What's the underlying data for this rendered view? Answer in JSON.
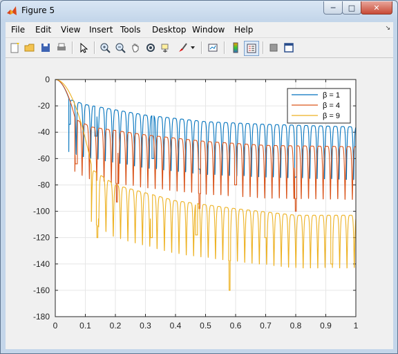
{
  "window": {
    "title": "Figure 5"
  },
  "window_controls": {
    "minimize": "─",
    "maximize": "□",
    "close": "✕"
  },
  "menu": {
    "items": [
      "File",
      "Edit",
      "View",
      "Insert",
      "Tools",
      "Desktop",
      "Window",
      "Help"
    ],
    "overflow_arrow": "↘"
  },
  "toolbar": {
    "icons": [
      "new-figure-icon",
      "open-file-icon",
      "save-icon",
      "print-icon",
      "pointer-icon",
      "zoom-in-icon",
      "zoom-out-icon",
      "pan-icon",
      "rotate-icon",
      "data-cursor-icon",
      "brush-icon",
      "brush-dropdown-icon",
      "link-plot-icon",
      "colorbar-icon",
      "legend-icon",
      "hide-plot-tools-icon",
      "show-plot-tools-icon"
    ]
  },
  "colors": {
    "beta1": "#0072BD",
    "beta4": "#D95319",
    "beta9": "#EDB120"
  },
  "chart_data": {
    "type": "line",
    "title": "",
    "xlabel": "",
    "ylabel": "",
    "xlim": [
      0,
      1
    ],
    "ylim": [
      -180,
      0
    ],
    "x_ticks": [
      "0",
      "0.1",
      "0.2",
      "0.3",
      "0.4",
      "0.5",
      "0.6",
      "0.7",
      "0.8",
      "0.9",
      "1"
    ],
    "y_ticks": [
      "0",
      "-20",
      "-40",
      "-60",
      "-80",
      "-100",
      "-120",
      "-140",
      "-160",
      "-180"
    ],
    "grid": true,
    "legend_position": "top-right",
    "series": [
      {
        "name": "β = 1",
        "color": "#0072BD",
        "mainlobe_null": 0.045,
        "envelope": [
          [
            0.045,
            -15
          ],
          [
            0.1,
            -19
          ],
          [
            0.3,
            -27
          ],
          [
            0.5,
            -32
          ],
          [
            0.7,
            -34
          ],
          [
            1.0,
            -36
          ]
        ],
        "deep_nulls": [
          [
            0.047,
            -34
          ],
          [
            0.135,
            -43
          ],
          [
            0.325,
            -60
          ],
          [
            0.48,
            -68
          ],
          [
            0.8,
            -74
          ]
        ]
      },
      {
        "name": "β = 4",
        "color": "#D95319",
        "mainlobe_null": 0.065,
        "envelope": [
          [
            0.065,
            -30
          ],
          [
            0.12,
            -36
          ],
          [
            0.3,
            -42
          ],
          [
            0.5,
            -47
          ],
          [
            0.7,
            -50
          ],
          [
            1.0,
            -51
          ]
        ],
        "deep_nulls": [
          [
            0.07,
            -64
          ],
          [
            0.205,
            -93
          ],
          [
            0.48,
            -98
          ],
          [
            0.6,
            -80
          ],
          [
            0.8,
            -100
          ]
        ]
      },
      {
        "name": "β = 9",
        "color": "#EDB120",
        "mainlobe_null": 0.12,
        "envelope": [
          [
            0.12,
            -68
          ],
          [
            0.2,
            -80
          ],
          [
            0.4,
            -92
          ],
          [
            0.6,
            -98
          ],
          [
            0.8,
            -103
          ],
          [
            1.0,
            -103
          ]
        ],
        "deep_nulls": [
          [
            0.14,
            -120
          ],
          [
            0.32,
            -120
          ],
          [
            0.47,
            -118
          ],
          [
            0.58,
            -160
          ],
          [
            0.7,
            -120
          ],
          [
            0.92,
            -140
          ]
        ]
      }
    ]
  }
}
